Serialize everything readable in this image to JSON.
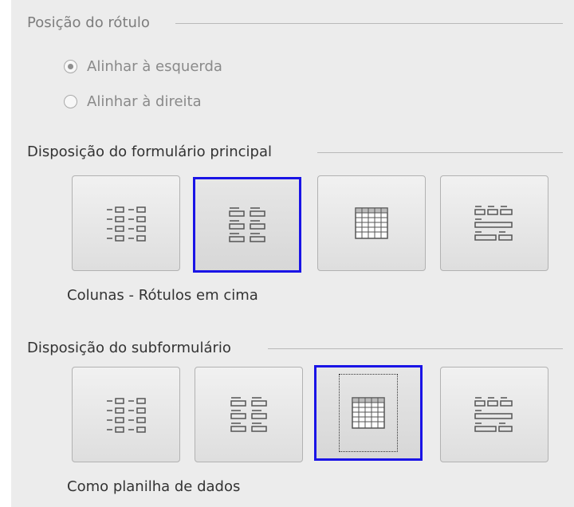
{
  "label_position": {
    "title": "Posição do rótulo",
    "options": [
      {
        "label": "Alinhar à esquerda",
        "checked": true
      },
      {
        "label": "Alinhar à direita",
        "checked": false
      }
    ]
  },
  "main_form": {
    "title": "Disposição do formulário principal",
    "selected_caption": "Colunas - Rótulos em cima",
    "selected_index": 1,
    "options": [
      {
        "icon": "columns-labels-left-icon"
      },
      {
        "icon": "columns-labels-top-icon"
      },
      {
        "icon": "datasheet-icon"
      },
      {
        "icon": "blocks-labels-top-icon"
      }
    ]
  },
  "sub_form": {
    "title": "Disposição do subformulário",
    "selected_caption": "Como planilha de dados",
    "selected_index": 2,
    "options": [
      {
        "icon": "columns-labels-left-icon"
      },
      {
        "icon": "columns-labels-top-icon"
      },
      {
        "icon": "datasheet-icon"
      },
      {
        "icon": "blocks-labels-top-icon"
      }
    ]
  },
  "colors": {
    "selection_border": "#1a14e6",
    "panel_bg": "#ececec"
  }
}
